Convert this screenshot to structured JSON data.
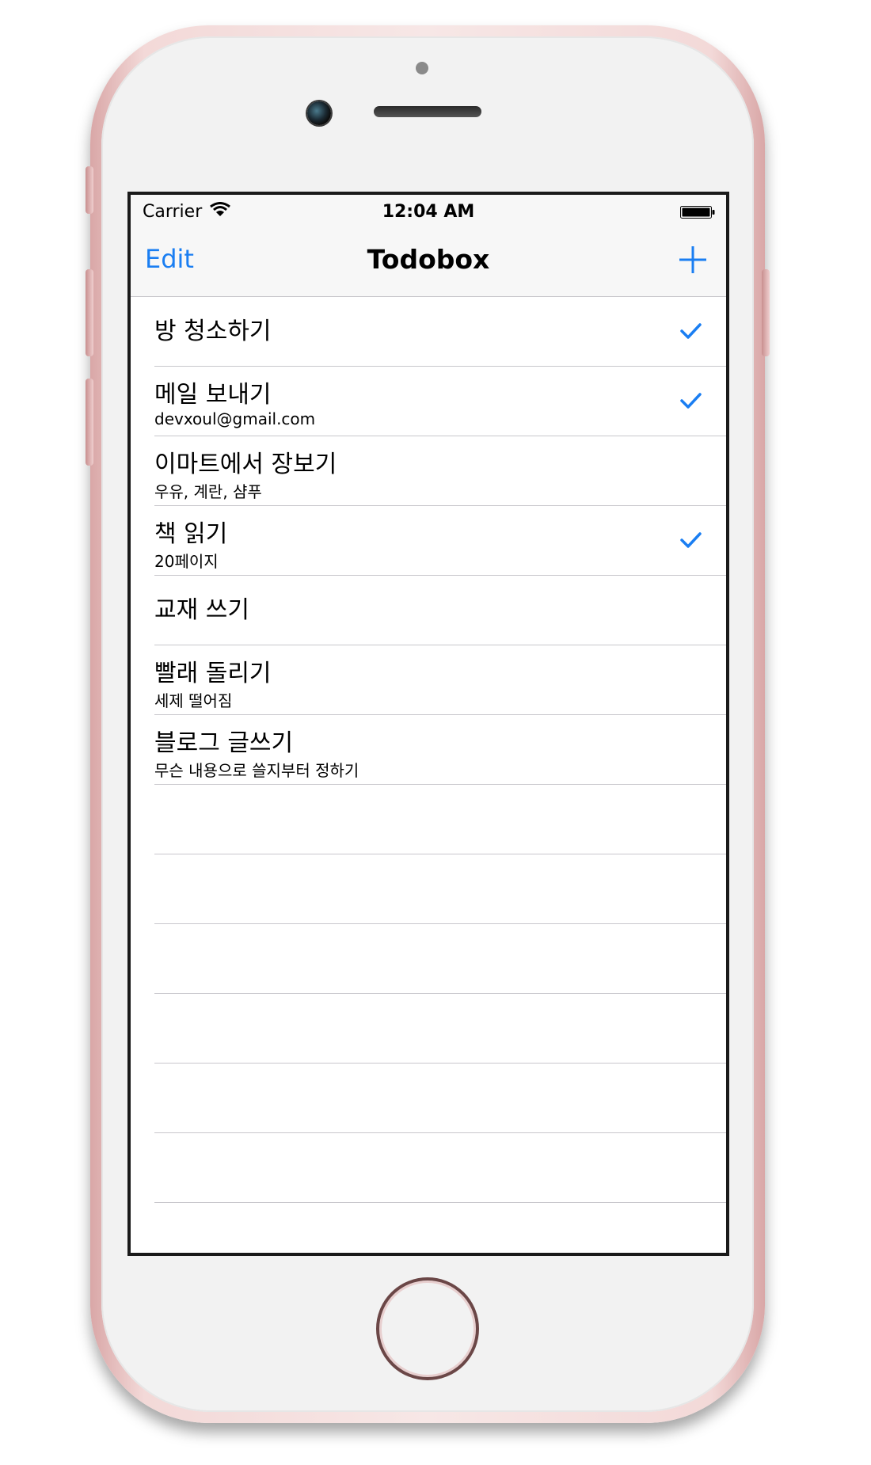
{
  "colors": {
    "accent": "#1a7ef2",
    "separator": "#c8c7cc",
    "bar_background": "#f7f7f7"
  },
  "status_bar": {
    "carrier": "Carrier",
    "time": "12:04 AM",
    "wifi_icon": "wifi-icon",
    "battery_icon": "battery-icon"
  },
  "nav_bar": {
    "edit_label": "Edit",
    "title": "Todobox",
    "add_icon": "plus-icon"
  },
  "todos": [
    {
      "title": "방 청소하기",
      "subtitle": "",
      "done": true
    },
    {
      "title": "메일 보내기",
      "subtitle": "devxoul@gmail.com",
      "done": true
    },
    {
      "title": "이마트에서 장보기",
      "subtitle": "우유, 계란, 샴푸",
      "done": false
    },
    {
      "title": "책 읽기",
      "subtitle": "20페이지",
      "done": true
    },
    {
      "title": "교재 쓰기",
      "subtitle": "",
      "done": false
    },
    {
      "title": "빨래 돌리기",
      "subtitle": "세제 떨어짐",
      "done": false
    },
    {
      "title": "블로그 글쓰기",
      "subtitle": "무슨 내용으로 쓸지부터 정하기",
      "done": false
    }
  ],
  "checkmark_icon": "checkmark-icon"
}
